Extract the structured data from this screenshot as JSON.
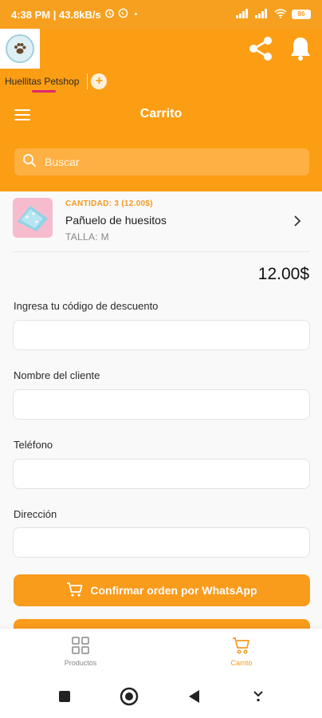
{
  "status_bar": {
    "time_speed": "4:38 PM | 43.8kB/s",
    "battery": "86"
  },
  "header": {
    "tab_label": "Huellitas Petshop",
    "tab_add": "+"
  },
  "title_bar": {
    "title": "Carrito",
    "search_placeholder": "Buscar"
  },
  "cart": {
    "items": [
      {
        "quantity_text": "CANTIDAD: 3 (12.00$)",
        "name": "Pañuelo de huesitos",
        "size": "TALLA: M"
      }
    ],
    "total": "12.00$"
  },
  "form": {
    "discount_label": "Ingresa tu código de descuento",
    "discount_value": "",
    "customer_label": "Nombre del cliente",
    "customer_value": "",
    "phone_label": "Teléfono",
    "phone_value": "",
    "address_label": "Dirección",
    "address_value": ""
  },
  "actions": {
    "confirm_label": "Confirmar orden por WhatsApp"
  },
  "bottom_nav": {
    "items": [
      {
        "label": "Productos",
        "icon": "grid-icon",
        "active": false
      },
      {
        "label": "Carrito",
        "icon": "cart-icon",
        "active": true
      }
    ]
  },
  "colors": {
    "brand": "#fb9e14",
    "button": "#f99b1b",
    "accent_underline": "#e0266c"
  }
}
